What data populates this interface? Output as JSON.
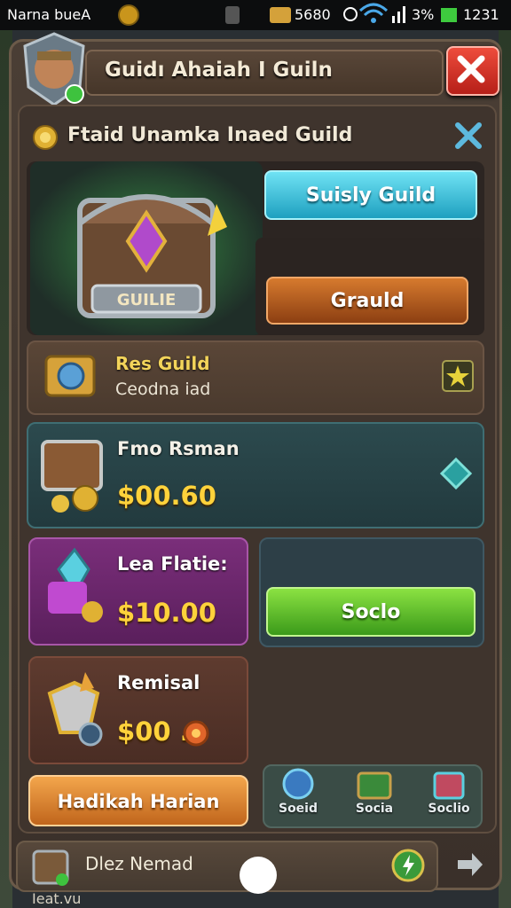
{
  "status": {
    "left_text": "Narna bueA",
    "mid_text": "5680",
    "battery_text": "3%",
    "time": "1231"
  },
  "header": {
    "title": "Guidı Ahaiah I Guiln"
  },
  "subheader": {
    "title": "Ftaid Unamka Inaed Guild"
  },
  "hero": {
    "crest_text": "GUILIE",
    "primary_button": "Suisly Guild",
    "secondary_button": "Grauld"
  },
  "rows": [
    {
      "title": "Res Guild",
      "subtitle": "Ceodna iad"
    },
    {
      "title": "Fmo Rsman",
      "price": "$00.60"
    },
    {
      "title": "Lea Flatie:",
      "price": "$10.00"
    },
    {
      "title": "Remisal",
      "price": "$00 .0"
    }
  ],
  "green_button": "Soclo",
  "orange_button": "Hadikah Harian",
  "nav": [
    {
      "label": "Soeid"
    },
    {
      "label": "Socia"
    },
    {
      "label": "Soclio"
    }
  ],
  "bottom": {
    "text": "Dlez Nemad",
    "footer": "Ieat.vu"
  },
  "colors": {
    "accent_gold": "#ffd23b",
    "teal": "#1ea0c0",
    "green": "#3b9a1a",
    "orange": "#c0651c",
    "close_red": "#d6302a"
  },
  "icons": [
    "search-coin-icon",
    "close-icon",
    "x-icon",
    "treasure-chest-icon",
    "star-icon",
    "diamond-icon",
    "crystal-icon",
    "cog-icon",
    "home-icon",
    "arrow-right-icon",
    "battery-icon",
    "wifi-icon"
  ]
}
